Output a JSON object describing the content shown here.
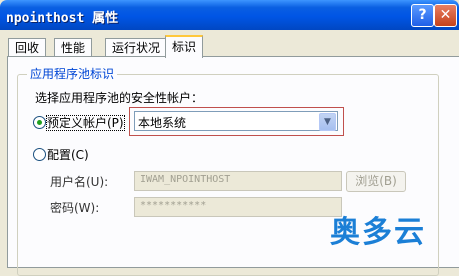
{
  "window": {
    "title": "npointhost 属性"
  },
  "titlebar": {
    "help_label": "?",
    "close_label": "✕"
  },
  "tabs": [
    {
      "label": "回收"
    },
    {
      "label": "性能"
    },
    {
      "label": "运行状况"
    },
    {
      "label": "标识",
      "active": true
    }
  ],
  "group": {
    "title": "应用程序池标识"
  },
  "prompt": "选择应用程序池的安全性帐户：",
  "predefined": {
    "label": "预定义帐户(P)",
    "selected": true,
    "dropdown_value": "本地系统"
  },
  "configurable": {
    "label": "配置(C)",
    "selected": false
  },
  "username": {
    "label": "用户名(U):",
    "value": "IWAM_NPOINTHOST"
  },
  "password": {
    "label": "密码(W):",
    "value": "***********"
  },
  "browse_label": "浏览(B)",
  "watermark": "奥多云",
  "colors": {
    "title_bar": "#0055e5",
    "accent_tab": "#ffc83c",
    "group_title": "#0046d5",
    "highlight_box": "#c0504d",
    "watermark": "#1b7fd6"
  }
}
